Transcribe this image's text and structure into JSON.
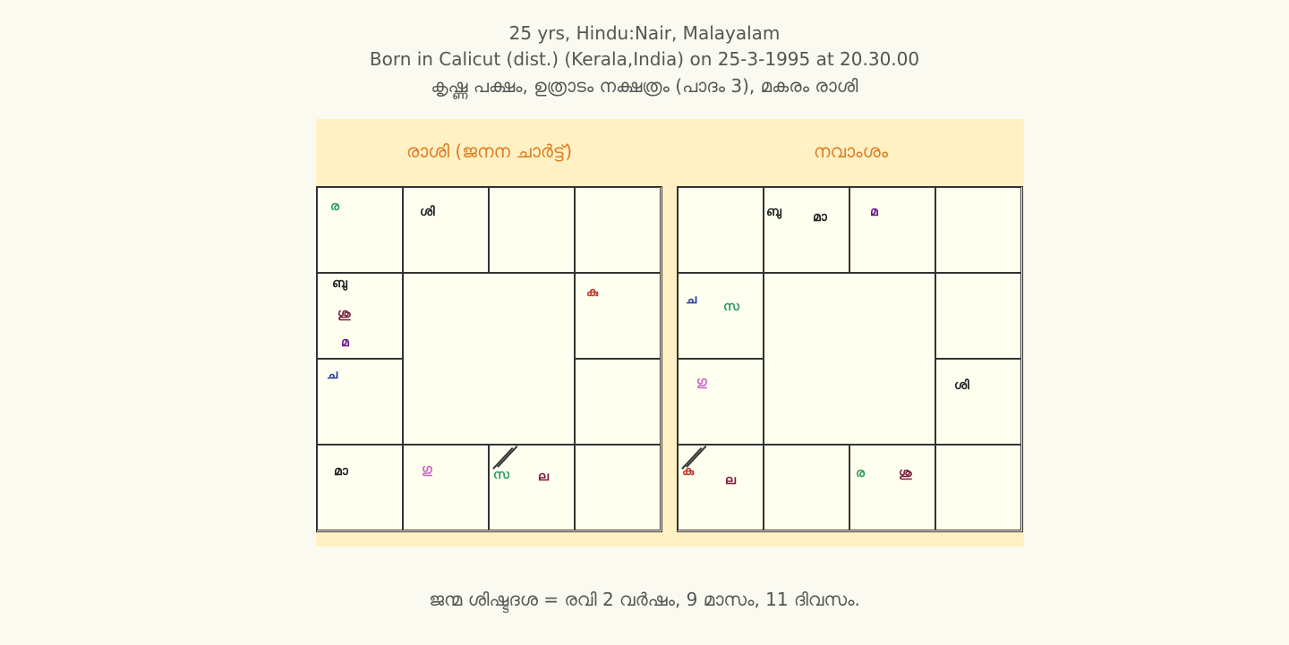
{
  "header": {
    "line1": "25 yrs, Hindu:Nair, Malayalam",
    "line2": "Born in Calicut (dist.) (Kerala,India) on 25-3-1995 at 20.30.00",
    "line3": "കൃഷ്ണ പക്ഷം, ഉത്രാടം നക്ഷത്രം (പാദം 3), മകരം രാശി"
  },
  "rasi_chart": {
    "title": "രാശി (ജനന ചാർട്ട്)",
    "cells": {
      "r0c0": [
        "ര"
      ],
      "r0c1": [
        "ശി"
      ],
      "r1c0": [
        "ബു",
        "ശു",
        "മ"
      ],
      "r1c3": [
        "കു"
      ],
      "r2c0": [
        "ച"
      ],
      "r3c0": [
        "മാ"
      ],
      "r3c1": [
        "ഗു"
      ],
      "r3c2": [
        "സ",
        "ല"
      ]
    }
  },
  "navamsa_chart": {
    "title": "നവാംശം",
    "cells": {
      "r0c1": [
        "ബു",
        "മാ"
      ],
      "r0c2": [
        "മ"
      ],
      "r1c0": [
        "ച",
        "സ"
      ],
      "r2c0": [
        "ഗു"
      ],
      "r2c3": [
        "ശി"
      ],
      "r3c0": [
        "കു",
        "ല"
      ],
      "r3c2": [
        "ര",
        "ശു"
      ]
    }
  },
  "dasa_balance": "ജന്മ ശിഷ്ടദശ = രവി 2 വർഷം, 9 മാസം, 11 ദിവസം."
}
